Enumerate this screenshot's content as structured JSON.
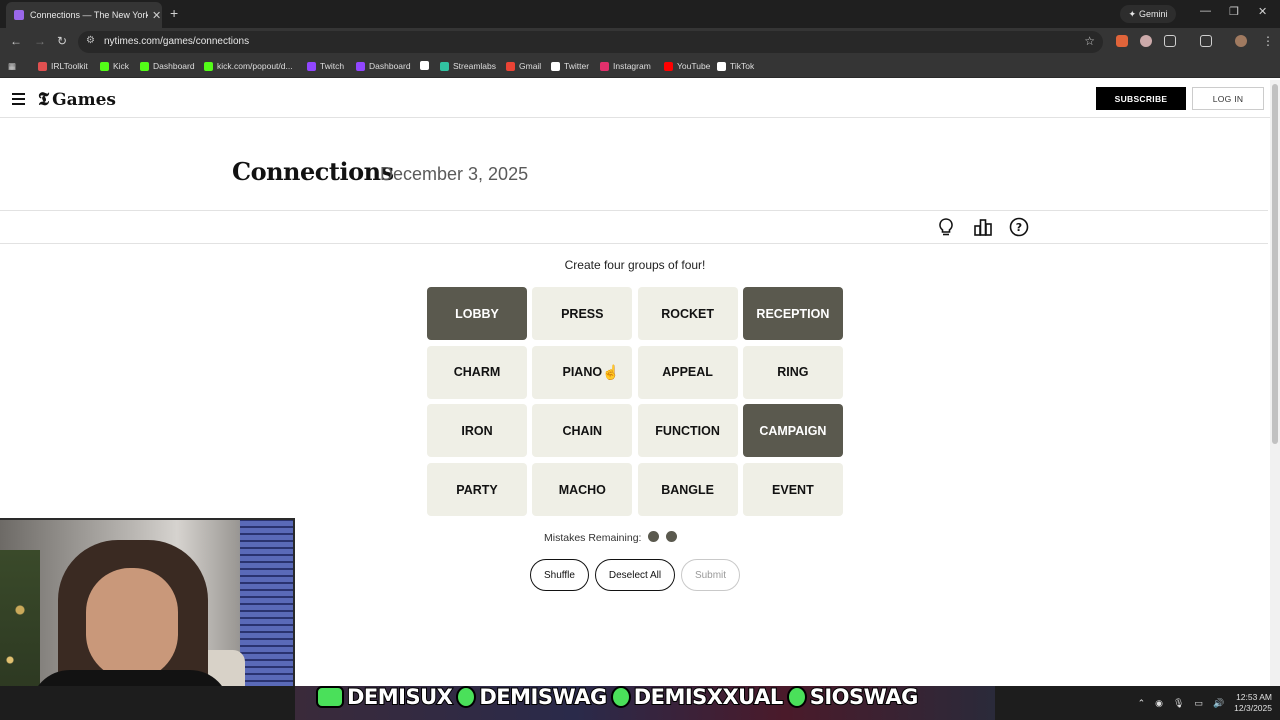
{
  "browser": {
    "tab_title": "Connections — The New York T",
    "new_tab": "+",
    "gemini_label": "Gemini",
    "url": "nytimes.com/games/connections",
    "bookmarks": [
      {
        "label": "IRLToolkit",
        "color": "#e05050"
      },
      {
        "label": "Kick",
        "color": "#53fc18"
      },
      {
        "label": "Dashboard",
        "color": "#53fc18"
      },
      {
        "label": "kick.com/popout/d...",
        "color": "#53fc18"
      },
      {
        "label": "Twitch",
        "color": "#9146ff"
      },
      {
        "label": "Dashboard",
        "color": "#9146ff"
      },
      {
        "label": "",
        "color": "#ffffff"
      },
      {
        "label": "Streamlabs",
        "color": "#31c3a2"
      },
      {
        "label": "Gmail",
        "color": "#ea4335"
      },
      {
        "label": "Twitter",
        "color": "#ffffff"
      },
      {
        "label": "Instagram",
        "color": "#e1306c"
      },
      {
        "label": "YouTube",
        "color": "#ff0000"
      },
      {
        "label": "TikTok",
        "color": "#ffffff"
      }
    ]
  },
  "header": {
    "logo_mark": "𝕿",
    "logo_text": "Games",
    "subscribe": "SUBSCRIBE",
    "login": "LOG IN"
  },
  "game": {
    "title": "Connections",
    "date": "December 3, 2025",
    "instructions": "Create four groups of four!",
    "words": [
      {
        "text": "LOBBY",
        "selected": true
      },
      {
        "text": "PRESS",
        "selected": false
      },
      {
        "text": "ROCKET",
        "selected": false
      },
      {
        "text": "RECEPTION",
        "selected": true
      },
      {
        "text": "CHARM",
        "selected": false
      },
      {
        "text": "PIANO",
        "selected": false
      },
      {
        "text": "APPEAL",
        "selected": false
      },
      {
        "text": "RING",
        "selected": false
      },
      {
        "text": "IRON",
        "selected": false
      },
      {
        "text": "CHAIN",
        "selected": false
      },
      {
        "text": "FUNCTION",
        "selected": false
      },
      {
        "text": "CAMPAIGN",
        "selected": true
      },
      {
        "text": "PARTY",
        "selected": false
      },
      {
        "text": "MACHO",
        "selected": false
      },
      {
        "text": "BANGLE",
        "selected": false
      },
      {
        "text": "EVENT",
        "selected": false
      }
    ],
    "mistakes_label": "Mistakes Remaining:",
    "mistakes_remaining": 2,
    "buttons": {
      "shuffle": "Shuffle",
      "deselect": "Deselect All",
      "submit": "Submit"
    },
    "toolbar_icons": [
      "lightbulb-icon",
      "leaderboard-icon",
      "help-icon"
    ],
    "selected_color": "#5a594e",
    "card_color": "#efefe6"
  },
  "stream": {
    "socials": [
      {
        "icon": "youtube-icon",
        "handle": "DEMISUX"
      },
      {
        "icon": "tiktok-icon",
        "handle": "DEMISWAG"
      },
      {
        "icon": "twitter-icon",
        "handle": "DEMISXXUAL"
      },
      {
        "icon": "snapchat-icon",
        "handle": "SIOSWAG"
      }
    ],
    "clock_time": "12:53 AM",
    "clock_date": "12/3/2025"
  }
}
